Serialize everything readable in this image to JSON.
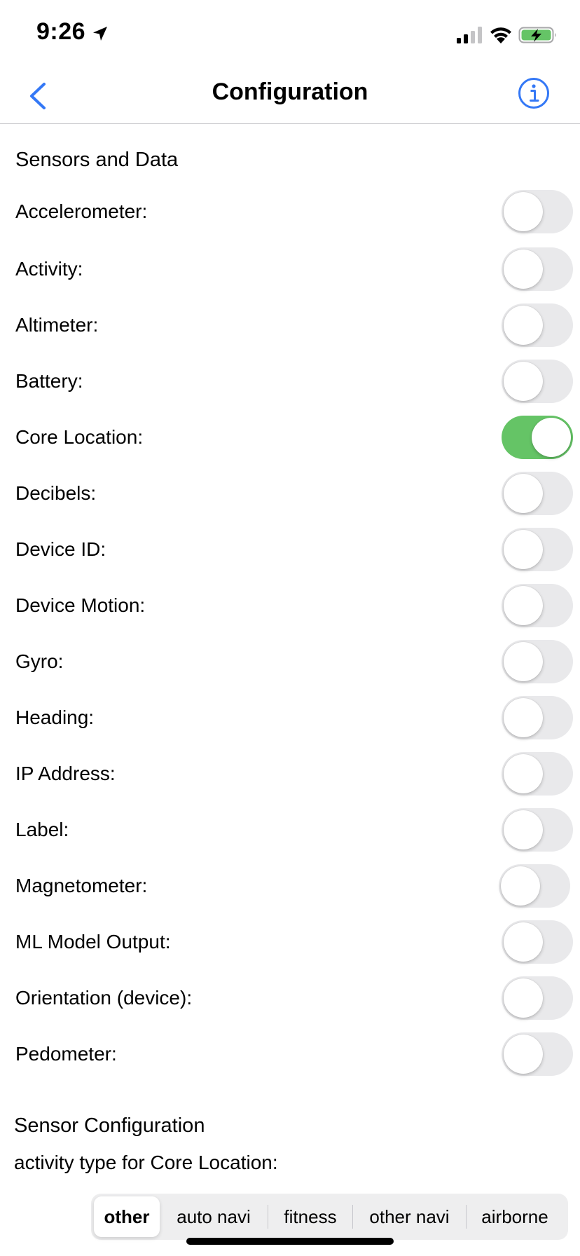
{
  "status_bar": {
    "time": "9:26"
  },
  "nav": {
    "title": "Configuration",
    "back_icon": "chevron-left-icon",
    "info_icon": "info-circle-icon"
  },
  "colors": {
    "accent": "#3478f6",
    "toggle_on": "#65c466",
    "toggle_off": "#e9e9eb",
    "battery_charging": "#65c466"
  },
  "sensors_section": {
    "title": "Sensors and Data",
    "items": [
      {
        "label": "Accelerometer:",
        "on": false
      },
      {
        "label": "Activity:",
        "on": false
      },
      {
        "label": "Altimeter:",
        "on": false
      },
      {
        "label": "Battery:",
        "on": false
      },
      {
        "label": "Core Location:",
        "on": true
      },
      {
        "label": "Decibels:",
        "on": false
      },
      {
        "label": "Device ID:",
        "on": false
      },
      {
        "label": "Device Motion:",
        "on": false
      },
      {
        "label": "Gyro:",
        "on": false
      },
      {
        "label": "Heading:",
        "on": false
      },
      {
        "label": "IP Address:",
        "on": false
      },
      {
        "label": "Label:",
        "on": false
      },
      {
        "label": "Magnetometer:",
        "on": false
      },
      {
        "label": "ML Model Output:",
        "on": false
      },
      {
        "label": "Orientation (device):",
        "on": false
      },
      {
        "label": "Pedometer:",
        "on": false
      }
    ]
  },
  "sensor_config": {
    "title": "Sensor Configuration",
    "activity_type_label": "activity type for Core Location:",
    "segments": [
      "other",
      "auto navi",
      "fitness",
      "other navi",
      "airborne"
    ],
    "selected": "other"
  }
}
